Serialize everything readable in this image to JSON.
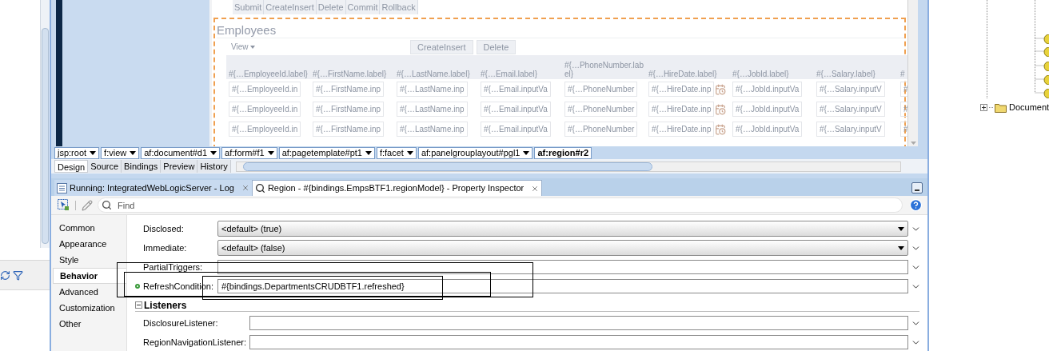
{
  "editor": {
    "action_buttons": [
      "Submit",
      "CreateInsert",
      "Delete",
      "Commit",
      "Rollback"
    ],
    "section_title": "Employees",
    "view_menu": "View",
    "table_buttons": [
      "CreateInsert",
      "Delete"
    ],
    "table": {
      "columns": [
        {
          "header": "#{…EmployeeId.label}",
          "kind": "text"
        },
        {
          "header": "#{…FirstName.label}",
          "kind": "text"
        },
        {
          "header": "#{…LastName.label}",
          "kind": "text"
        },
        {
          "header": "#{…Email.label}",
          "kind": "text"
        },
        {
          "header": "#{…PhoneNumber.label}",
          "kind": "text"
        },
        {
          "header": "#{…HireDate.label}",
          "kind": "date"
        },
        {
          "header": "#{…JobId.label}",
          "kind": "text"
        },
        {
          "header": "#{…Salary.label}",
          "kind": "text"
        },
        {
          "header": "#",
          "kind": "text"
        }
      ],
      "rows": [
        [
          "#{…EmployeeId.in",
          "#{…FirstName.inp",
          "#{…LastName.inp",
          "#{…Email.inputVa",
          "#{…PhoneNumber",
          "#{…HireDate.inp",
          "#{…JobId.inputVa",
          "#{…Salary.inputV",
          "#"
        ],
        [
          "#{…EmployeeId.in",
          "#{…FirstName.inp",
          "#{…LastName.inp",
          "#{…Email.inputVa",
          "#{…PhoneNumber",
          "#{…HireDate.inp",
          "#{…JobId.inputVa",
          "#{…Salary.inputV",
          "#"
        ],
        [
          "#{…EmployeeId.in",
          "#{…FirstName.inp",
          "#{…LastName.inp",
          "#{…Email.inputVa",
          "#{…PhoneNumber",
          "#{…HireDate.inp",
          "#{…JobId.inputVa",
          "#{…Salary.inputV",
          "#"
        ]
      ]
    },
    "breadcrumb": [
      {
        "label": "jsp:root",
        "selected": false
      },
      {
        "label": "f:view",
        "selected": false
      },
      {
        "label": "af:document#d1",
        "selected": false
      },
      {
        "label": "af:form#f1",
        "selected": false
      },
      {
        "label": "af:pagetemplate#pt1",
        "selected": false
      },
      {
        "label": "f:facet",
        "selected": false
      },
      {
        "label": "af:panelgrouplayout#pgl1",
        "selected": false
      },
      {
        "label": "af:region#r2",
        "selected": true
      }
    ],
    "tabs": [
      {
        "label": "Design",
        "selected": true
      },
      {
        "label": "Source",
        "selected": false
      },
      {
        "label": "Bindings",
        "selected": false
      },
      {
        "label": "Preview",
        "selected": false
      },
      {
        "label": "History",
        "selected": false
      }
    ]
  },
  "inspector": {
    "tabs": [
      {
        "label": "Running: IntegratedWebLogicServer - Log",
        "kind": "log",
        "selected": false
      },
      {
        "label": "Region - #{bindings.EmpsBTF1.regionModel} - Property Inspector",
        "kind": "inspector",
        "selected": true
      }
    ],
    "search": {
      "placeholder": "Find"
    },
    "categories": [
      {
        "label": "Common",
        "selected": false
      },
      {
        "label": "Appearance",
        "selected": false
      },
      {
        "label": "Style",
        "selected": false
      },
      {
        "label": "Behavior",
        "selected": true
      },
      {
        "label": "Advanced",
        "selected": false
      },
      {
        "label": "Customization",
        "selected": false
      },
      {
        "label": "Other",
        "selected": false
      }
    ],
    "properties": [
      {
        "label": "Disclosed:",
        "kind": "dropdown",
        "value": "<default> (true)",
        "set": false
      },
      {
        "label": "Immediate:",
        "kind": "dropdown",
        "value": "<default> (false)",
        "set": false
      },
      {
        "label": "PartialTriggers:",
        "kind": "text",
        "set": false
      },
      {
        "label": "RefreshCondition:",
        "kind": "text",
        "value": "#{bindings.DepartmentsCRUDBTF1.refreshed}",
        "set": true
      }
    ],
    "sections": [
      {
        "title": "Listeners",
        "expanded": true,
        "properties": [
          {
            "label": "DisclosureListener:",
            "kind": "text",
            "set": false
          },
          {
            "label": "RegionNavigationListener:",
            "kind": "text",
            "set": false
          }
        ]
      }
    ]
  },
  "tree": {
    "items": [
      {
        "label": "Document",
        "expanded": false
      }
    ]
  }
}
